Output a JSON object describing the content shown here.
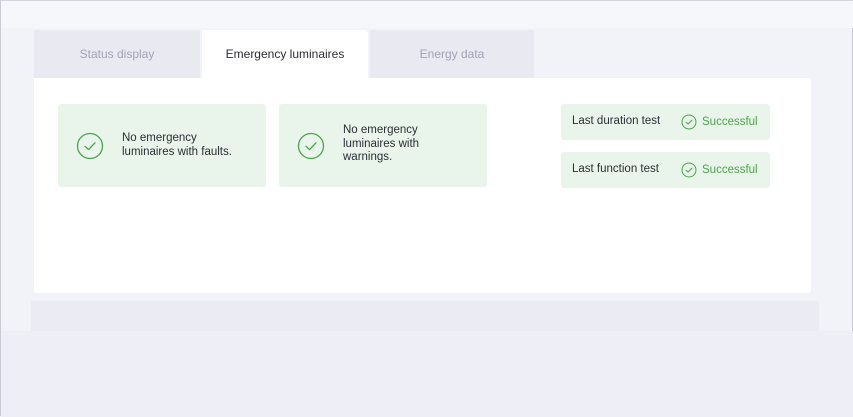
{
  "tabs": [
    {
      "label": "Status display",
      "active": false
    },
    {
      "label": "Emergency luminaires",
      "active": true
    },
    {
      "label": "Energy data",
      "active": false
    }
  ],
  "cards": {
    "faults": {
      "text": "No emergency luminaires with faults.",
      "icon": "check-circle-icon"
    },
    "warnings": {
      "text": "No emergency luminaires with warnings.",
      "icon": "check-circle-icon"
    }
  },
  "tests": {
    "duration": {
      "label": "Last duration test",
      "result": "Successful",
      "icon": "check-circle-icon"
    },
    "function": {
      "label": "Last function test",
      "result": "Successful",
      "icon": "check-circle-icon"
    }
  },
  "colors": {
    "success_green": "#4aa54a",
    "success_bg": "#e9f5ea",
    "panel_bg": "#ffffff",
    "page_bg": "#f2f3f9",
    "tab_inactive_text": "#a0a3b8"
  }
}
